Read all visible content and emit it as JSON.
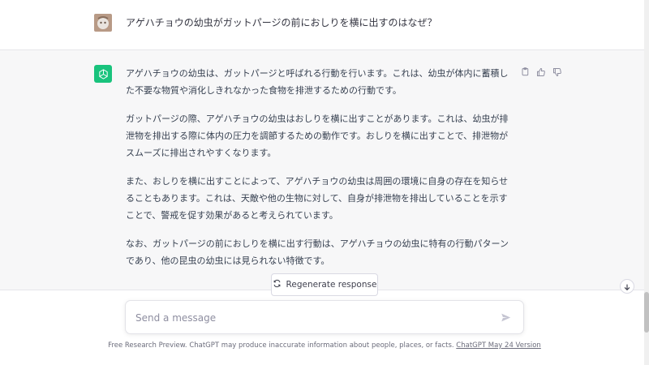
{
  "sidebar": {
    "toggle_icon": "sidebar-toggle-icon"
  },
  "user_message": {
    "text": "アゲハチョウの幼虫がガットパージの前におしりを横に出すのはなぜ？"
  },
  "assistant_message": {
    "paragraphs": [
      "アゲハチョウの幼虫は、ガットパージと呼ばれる行動を行います。これは、幼虫が体内に蓄積した不要な物質や消化しきれなかった食物を排泄するための行動です。",
      "ガットパージの際、アゲハチョウの幼虫はおしりを横に出すことがあります。これは、幼虫が排泄物を排出する際に体内の圧力を調節するための動作です。おしりを横に出すことで、排泄物がスムーズに排出されやすくなります。",
      "また、おしりを横に出すことによって、アゲハチョウの幼虫は周囲の環境に自身の存在を知らせることもあります。これは、天敵や他の生物に対して、自身が排泄物を排出していることを示すことで、警戒を促す効果があると考えられています。",
      "なお、ガットパージの前におしりを横に出す行動は、アゲハチョウの幼虫に特有の行動パターンであり、他の昆虫の幼虫には見られない特徴です。"
    ],
    "actions": [
      "copy-icon",
      "thumbs-up-icon",
      "thumbs-down-icon"
    ]
  },
  "regenerate": {
    "label": "Regenerate response",
    "icon": "refresh-icon"
  },
  "composer": {
    "placeholder": "Send a message",
    "value": ""
  },
  "footer": {
    "text": "Free Research Preview. ChatGPT may produce inaccurate information about people, places, or facts. ",
    "link": "ChatGPT May 24 Version"
  },
  "colors": {
    "brand": "#19c37d",
    "assistant_bg": "#f7f7f8",
    "text": "#374151"
  }
}
